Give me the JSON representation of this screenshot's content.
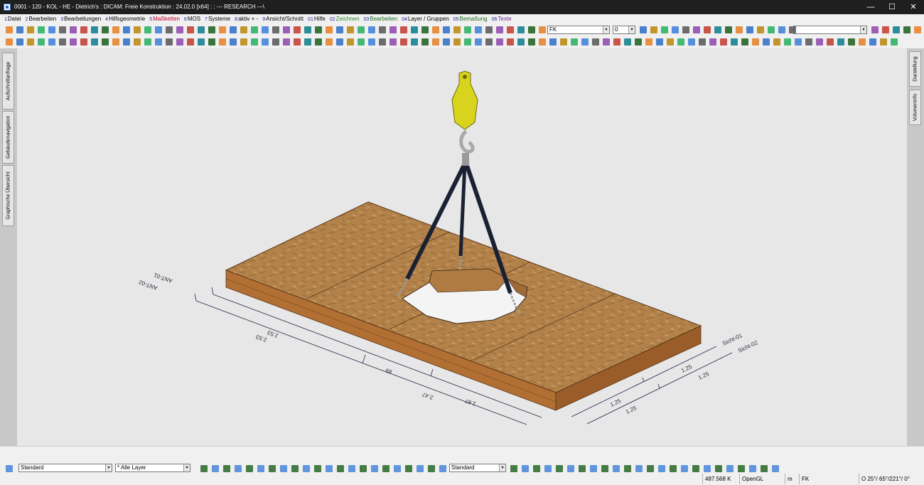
{
  "window": {
    "title": "0001 - 120 - KOL - HE - Dietrich's : DICAM: Freie Konstruktion : 24.02.0 [x64] : : --- RESEARCH ---\\",
    "minimize": "—",
    "maximize": "☐",
    "close": "✕"
  },
  "menu": [
    {
      "num": "1",
      "label": "Datei",
      "color": "m-black"
    },
    {
      "num": "2",
      "label": "Bearbeiten",
      "color": "m-black"
    },
    {
      "num": "3",
      "label": "Bearbeitungen",
      "color": "m-black"
    },
    {
      "num": "4",
      "label": "Hilfsgeometrie",
      "color": "m-black"
    },
    {
      "num": "5",
      "label": "Maßketten",
      "color": "m-red"
    },
    {
      "num": "6",
      "label": "MOS",
      "color": "m-black"
    },
    {
      "num": "7",
      "label": "Systeme",
      "color": "m-black"
    },
    {
      "num": "8",
      "label": "aktiv + -",
      "color": "m-black"
    },
    {
      "num": "9",
      "label": "Ansicht/Schnitt",
      "color": "m-black"
    },
    {
      "num": "01",
      "label": "Hilfe",
      "color": "m-black"
    },
    {
      "num": "02",
      "label": "Zeichnen",
      "color": "m-green"
    },
    {
      "num": "03",
      "label": "Bearbeiten",
      "color": "m-darkgreen"
    },
    {
      "num": "04",
      "label": "Layer / Gruppen",
      "color": "m-black"
    },
    {
      "num": "05",
      "label": "Bemaßung",
      "color": "m-darkgreen"
    },
    {
      "num": "06",
      "label": "Texte",
      "color": "m-purple"
    }
  ],
  "toolbar": {
    "fk_combo": "FK",
    "number_combo": "0",
    "empty_combo": ""
  },
  "sidebar_left": {
    "tab_top": "Aufschnittanfrage",
    "tab_mid": "Gebäudenavigation",
    "tab_bottom": "Graphische Übersicht"
  },
  "sidebar_right": {
    "tab_top": "Darstellung",
    "tab_bottom": "Volumeninfo"
  },
  "dimensions": {
    "left_label_1": "2.53",
    "left_label_2": "2.53",
    "left_label_3": "89",
    "left_label_4": "2.47",
    "left_label_5": "1.67",
    "left_end_1": "ANT-01",
    "left_end_2": "ANT-02",
    "right_label_1": "1.25",
    "right_label_2": "1.25",
    "right_label_3": "1.25",
    "right_label_4": "1.25",
    "right_end_1": "Sicht-01",
    "right_end_2": "Sicht-02"
  },
  "statusbar": {
    "style_combo": "Standard",
    "layer_combo": "* Alle Layer",
    "style_combo_2": "Standard",
    "coords": "487.568 K",
    "renderer": "OpenGL",
    "unit": "m",
    "mode": "FK",
    "angle": "O 25°/ 65°/221°/ 0°"
  },
  "colors": {
    "viewport_bg": "#e7e7e7",
    "osb": "#b3824a",
    "beam": "#a0632b",
    "hook": "#d8d31c",
    "strap": "#1a2133"
  }
}
